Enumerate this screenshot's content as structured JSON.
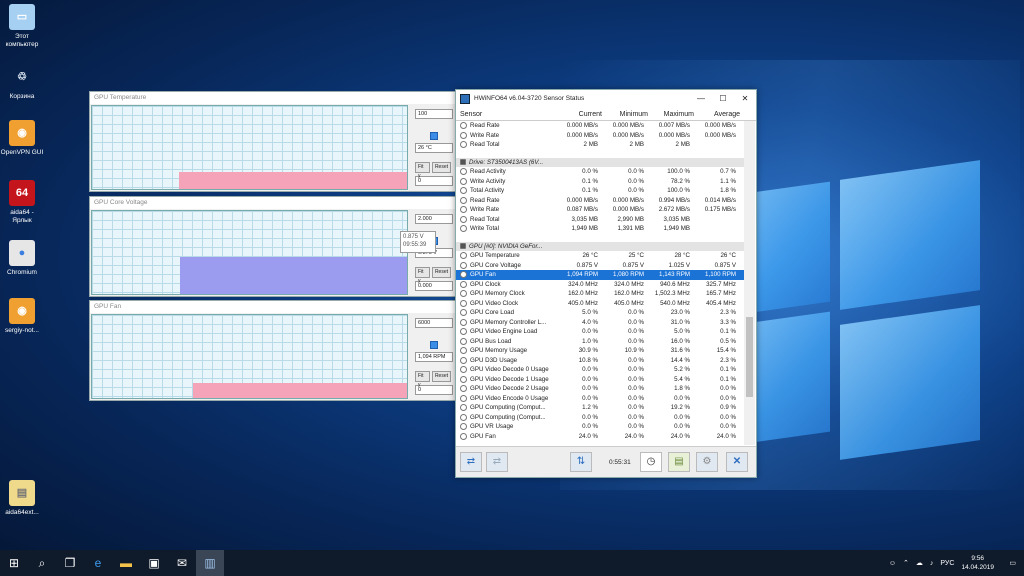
{
  "desktop": {
    "icons": [
      {
        "label": "Этот компьютер",
        "icon": "computer-icon"
      },
      {
        "label": "Корзина",
        "icon": "recycle-bin-icon"
      },
      {
        "label": "OpenVPN GUI",
        "icon": "openvpn-icon"
      },
      {
        "label": "aida64 - Ярлык",
        "icon": "aida64-icon",
        "glyph": "64"
      },
      {
        "label": "Chromium",
        "icon": "chromium-icon"
      },
      {
        "label": "sergiy-not...",
        "icon": "openvpn-icon"
      },
      {
        "label": "aida64ext...",
        "icon": "file-icon"
      }
    ]
  },
  "graphs": [
    {
      "title": "GPU Temperature",
      "max": "100",
      "current": "26 °C",
      "min": "0",
      "fill_color": "#f4a3b8",
      "fill_level": 0.21,
      "fill_start": 0.275
    },
    {
      "title": "GPU Core Voltage",
      "max": "2.000",
      "current": "0.875 V",
      "min": "0.000",
      "fill_color": "#9b9bef",
      "fill_level": 0.44,
      "fill_start": 0.28
    },
    {
      "title": "GPU Fan",
      "max": "6000",
      "current": "1,094 RPM",
      "min": "0",
      "fill_color": "#f4a3b8",
      "fill_level": 0.18,
      "fill_start": 0.32
    }
  ],
  "graph_buttons": {
    "fit": "Fit y",
    "reset": "Reset"
  },
  "tooltip": {
    "value": "0.875 V",
    "time": "09:55:39"
  },
  "hwinfo": {
    "title": "HWiNFO64 v6.04-3720 Sensor Status",
    "window_controls": {
      "minimize": "—",
      "maximize": "☐",
      "close": "✕"
    },
    "columns": [
      "Sensor",
      "Current",
      "Minimum",
      "Maximum",
      "Average"
    ],
    "rows": [
      {
        "type": "data",
        "name": "Read Rate",
        "cur": "0.000 MB/s",
        "min": "0.000 MB/s",
        "max": "0.007 MB/s",
        "avg": "0.000 MB/s"
      },
      {
        "type": "data",
        "name": "Write Rate",
        "cur": "0.000 MB/s",
        "min": "0.000 MB/s",
        "max": "0.000 MB/s",
        "avg": "0.000 MB/s"
      },
      {
        "type": "data",
        "name": "Read Total",
        "cur": "2 MB",
        "min": "2 MB",
        "max": "2 MB",
        "avg": ""
      },
      {
        "type": "blank"
      },
      {
        "type": "group",
        "name": "Drive: ST3500413AS (6V..."
      },
      {
        "type": "data",
        "name": "Read Activity",
        "cur": "0.0 %",
        "min": "0.0 %",
        "max": "100.0 %",
        "avg": "0.7 %"
      },
      {
        "type": "data",
        "name": "Write Activity",
        "cur": "0.1 %",
        "min": "0.0 %",
        "max": "78.2 %",
        "avg": "1.1 %"
      },
      {
        "type": "data",
        "name": "Total Activity",
        "cur": "0.1 %",
        "min": "0.0 %",
        "max": "100.0 %",
        "avg": "1.8 %"
      },
      {
        "type": "data",
        "name": "Read Rate",
        "cur": "0.000 MB/s",
        "min": "0.000 MB/s",
        "max": "0.994 MB/s",
        "avg": "0.014 MB/s"
      },
      {
        "type": "data",
        "name": "Write Rate",
        "cur": "0.087 MB/s",
        "min": "0.000 MB/s",
        "max": "2.672 MB/s",
        "avg": "0.175 MB/s"
      },
      {
        "type": "data",
        "name": "Read Total",
        "cur": "3,035 MB",
        "min": "2,990 MB",
        "max": "3,035 MB",
        "avg": ""
      },
      {
        "type": "data",
        "name": "Write Total",
        "cur": "1,949 MB",
        "min": "1,391 MB",
        "max": "1,949 MB",
        "avg": ""
      },
      {
        "type": "blank"
      },
      {
        "type": "group",
        "name": "GPU [#0]: NVIDIA GeFor..."
      },
      {
        "type": "data",
        "name": "GPU Temperature",
        "cur": "26 °C",
        "min": "25 °C",
        "max": "28 °C",
        "avg": "26 °C"
      },
      {
        "type": "data",
        "name": "GPU Core Voltage",
        "cur": "0.875 V",
        "min": "0.875 V",
        "max": "1.025 V",
        "avg": "0.875 V"
      },
      {
        "type": "data",
        "selected": true,
        "name": "GPU Fan",
        "cur": "1,094 RPM",
        "min": "1,080 RPM",
        "max": "1,143 RPM",
        "avg": "1,100 RPM"
      },
      {
        "type": "data",
        "name": "GPU Clock",
        "cur": "324.0 MHz",
        "min": "324.0 MHz",
        "max": "940.6 MHz",
        "avg": "325.7 MHz"
      },
      {
        "type": "data",
        "name": "GPU Memory Clock",
        "cur": "162.0 MHz",
        "min": "162.0 MHz",
        "max": "1,502.3 MHz",
        "avg": "165.7 MHz"
      },
      {
        "type": "data",
        "name": "GPU Video Clock",
        "cur": "405.0 MHz",
        "min": "405.0 MHz",
        "max": "540.0 MHz",
        "avg": "405.4 MHz"
      },
      {
        "type": "data",
        "name": "GPU Core Load",
        "cur": "5.0 %",
        "min": "0.0 %",
        "max": "23.0 %",
        "avg": "2.3 %"
      },
      {
        "type": "data",
        "name": "GPU Memory Controller L...",
        "cur": "4.0 %",
        "min": "0.0 %",
        "max": "31.0 %",
        "avg": "3.3 %"
      },
      {
        "type": "data",
        "name": "GPU Video Engine Load",
        "cur": "0.0 %",
        "min": "0.0 %",
        "max": "5.0 %",
        "avg": "0.1 %"
      },
      {
        "type": "data",
        "name": "GPU Bus Load",
        "cur": "1.0 %",
        "min": "0.0 %",
        "max": "16.0 %",
        "avg": "0.5 %"
      },
      {
        "type": "data",
        "name": "GPU Memory Usage",
        "cur": "30.9 %",
        "min": "10.9 %",
        "max": "31.6 %",
        "avg": "15.4 %"
      },
      {
        "type": "data",
        "name": "GPU D3D Usage",
        "cur": "10.8 %",
        "min": "0.0 %",
        "max": "14.4 %",
        "avg": "2.3 %"
      },
      {
        "type": "data",
        "name": "GPU Video Decode 0 Usage",
        "cur": "0.0 %",
        "min": "0.0 %",
        "max": "5.2 %",
        "avg": "0.1 %"
      },
      {
        "type": "data",
        "name": "GPU Video Decode 1 Usage",
        "cur": "0.0 %",
        "min": "0.0 %",
        "max": "5.4 %",
        "avg": "0.1 %"
      },
      {
        "type": "data",
        "name": "GPU Video Decode 2 Usage",
        "cur": "0.0 %",
        "min": "0.0 %",
        "max": "1.8 %",
        "avg": "0.0 %"
      },
      {
        "type": "data",
        "name": "GPU Video Encode 0 Usage",
        "cur": "0.0 %",
        "min": "0.0 %",
        "max": "0.0 %",
        "avg": "0.0 %"
      },
      {
        "type": "data",
        "name": "GPU Computing (Comput...",
        "cur": "1.2 %",
        "min": "0.0 %",
        "max": "19.2 %",
        "avg": "0.9 %"
      },
      {
        "type": "data",
        "name": "GPU Computing (Comput...",
        "cur": "0.0 %",
        "min": "0.0 %",
        "max": "0.0 %",
        "avg": "0.0 %"
      },
      {
        "type": "data",
        "name": "GPU VR Usage",
        "cur": "0.0 %",
        "min": "0.0 %",
        "max": "0.0 %",
        "avg": "0.0 %"
      },
      {
        "type": "data",
        "name": "GPU Fan",
        "cur": "24.0 %",
        "min": "24.0 %",
        "max": "24.0 %",
        "avg": "24.0 %"
      }
    ],
    "elapsed": "0:55:31"
  },
  "taskbar": {
    "language": "РУС",
    "time": "9:56",
    "date": "14.04.2019"
  },
  "colors": {
    "selection": "#1c73d6",
    "accent": "#2f6fbf"
  }
}
